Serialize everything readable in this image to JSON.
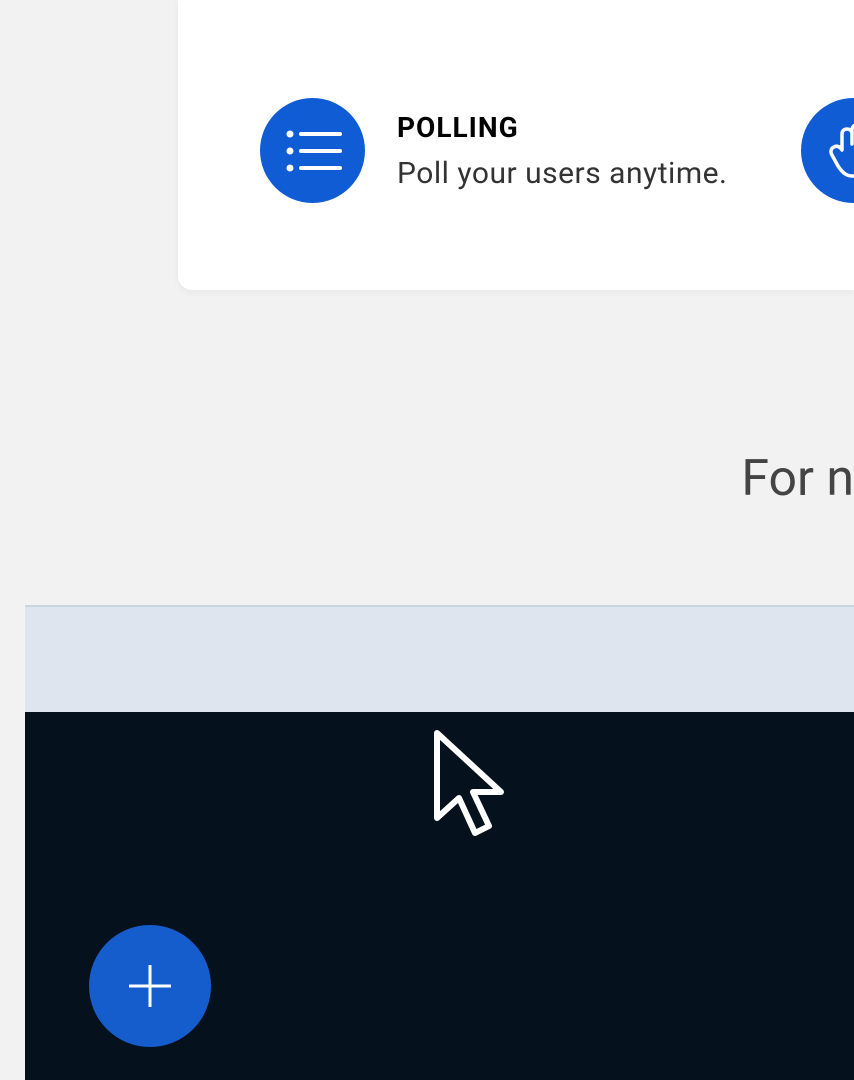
{
  "features": {
    "polling": {
      "title": "POLLING",
      "description": "Poll your users anytime."
    }
  },
  "section_heading": "For n"
}
